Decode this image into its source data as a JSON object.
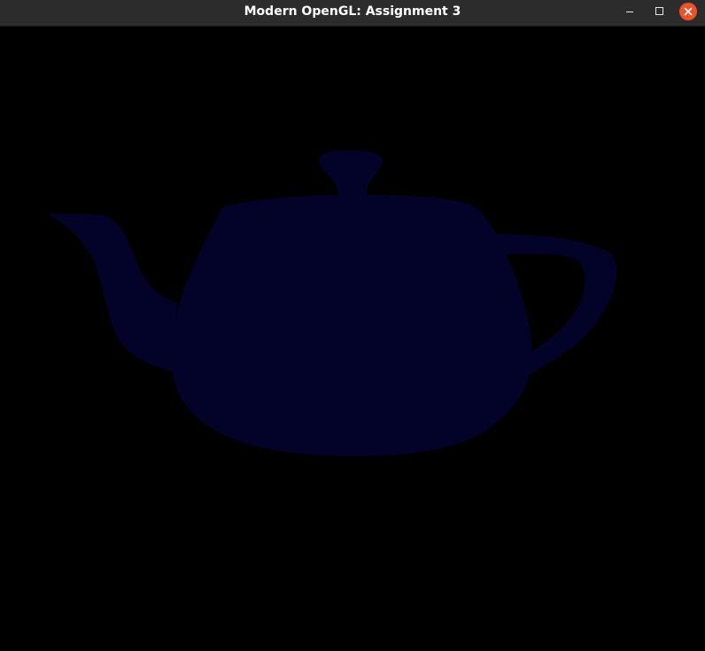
{
  "window": {
    "title": "Modern OpenGL: Assignment 3",
    "controls": {
      "minimize_icon": "minimize-icon",
      "maximize_icon": "maximize-icon",
      "close_icon": "close-icon",
      "close_color": "#e9542b"
    }
  },
  "viewport": {
    "background_color": "#000000",
    "model": "teapot",
    "model_color": "#03032a"
  }
}
